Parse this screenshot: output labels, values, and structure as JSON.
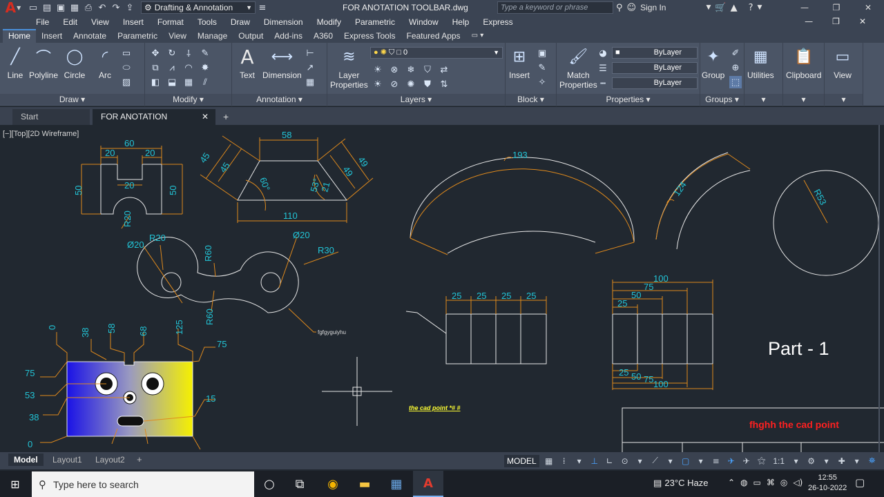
{
  "app": {
    "logo": "A",
    "workspace": "Drafting & Annotation",
    "document_title": "FOR ANOTATION TOOLBAR.dwg",
    "search_placeholder": "Type a keyword or phrase",
    "sign_in": "Sign In"
  },
  "menu": [
    "File",
    "Edit",
    "View",
    "Insert",
    "Format",
    "Tools",
    "Draw",
    "Dimension",
    "Modify",
    "Parametric",
    "Window",
    "Help",
    "Express"
  ],
  "ribbon_tabs": [
    "Home",
    "Insert",
    "Annotate",
    "Parametric",
    "View",
    "Manage",
    "Output",
    "Add-ins",
    "A360",
    "Express Tools",
    "Featured Apps"
  ],
  "ribbon": {
    "draw": {
      "label": "Draw",
      "line": "Line",
      "polyline": "Polyline",
      "circle": "Circle",
      "arc": "Arc"
    },
    "modify": {
      "label": "Modify"
    },
    "annotation": {
      "label": "Annotation",
      "text": "Text",
      "dimension": "Dimension"
    },
    "layers": {
      "label": "Layers",
      "layer_properties_1": "Layer",
      "layer_properties_2": "Properties",
      "current_layer": "0"
    },
    "block": {
      "label": "Block",
      "insert": "Insert"
    },
    "properties": {
      "label": "Properties",
      "match_1": "Match",
      "match_2": "Properties",
      "color": "ByLayer",
      "linetype": "ByLayer",
      "lineweight": "ByLayer"
    },
    "groups": {
      "label": "Groups",
      "group": "Group"
    },
    "utilities": "Utilities",
    "clipboard": "Clipboard",
    "view": "View"
  },
  "file_tabs": {
    "start": "Start",
    "active": "FOR ANOTATION TOOLBAR*"
  },
  "viewport_label": "[−][Top][2D Wireframe]",
  "drawing": {
    "dims_top_left": {
      "w60": "60",
      "a20": "20",
      "b20": "20",
      "c20": "20",
      "h50l": "50",
      "h50r": "50",
      "r20": "R20"
    },
    "dims_trap": {
      "top58": "58",
      "s45a": "45",
      "s45b": "45",
      "s49a": "49",
      "s49b": "49",
      "ang60": "60°",
      "ang53": "53°",
      "h21": "21",
      "bot110": "110"
    },
    "dims_link": {
      "d20l": "Ø20",
      "r20": "R20",
      "r60t": "R60",
      "d20r": "Ø20",
      "r30": "R30",
      "r60b": "R60",
      "leader_note": "fgfgyguiyhu"
    },
    "dims_arc": {
      "arc193": "193",
      "arc124": "124",
      "r53": "R53"
    },
    "dims_grid": {
      "c1": "25",
      "c2": "25",
      "c3": "25",
      "c4": "25"
    },
    "dims_baseline": {
      "d100": "100",
      "d75": "75",
      "d50": "50",
      "d25": "25",
      "b25": "25",
      "b50": "50",
      "b75": "75",
      "b100": "100"
    },
    "dims_ordinate": {
      "x0": "0",
      "x38": "38",
      "x58": "58",
      "x68": "68",
      "x125": "125",
      "y75r": "75",
      "y75": "75",
      "y53": "53",
      "y38": "38",
      "y0": "0",
      "y15": "15"
    },
    "part_label": "Part - 1",
    "red_note": "fhghh  the cad point",
    "yellow_note": "the cad point *#  #"
  },
  "layout_tabs": [
    "Model",
    "Layout1",
    "Layout2"
  ],
  "status": {
    "model": "MODEL",
    "scale": "1:1"
  },
  "taskbar": {
    "search_placeholder": "Type here to search",
    "weather": "23°C  Haze",
    "time": "12:55",
    "date": "26-10-2022"
  }
}
